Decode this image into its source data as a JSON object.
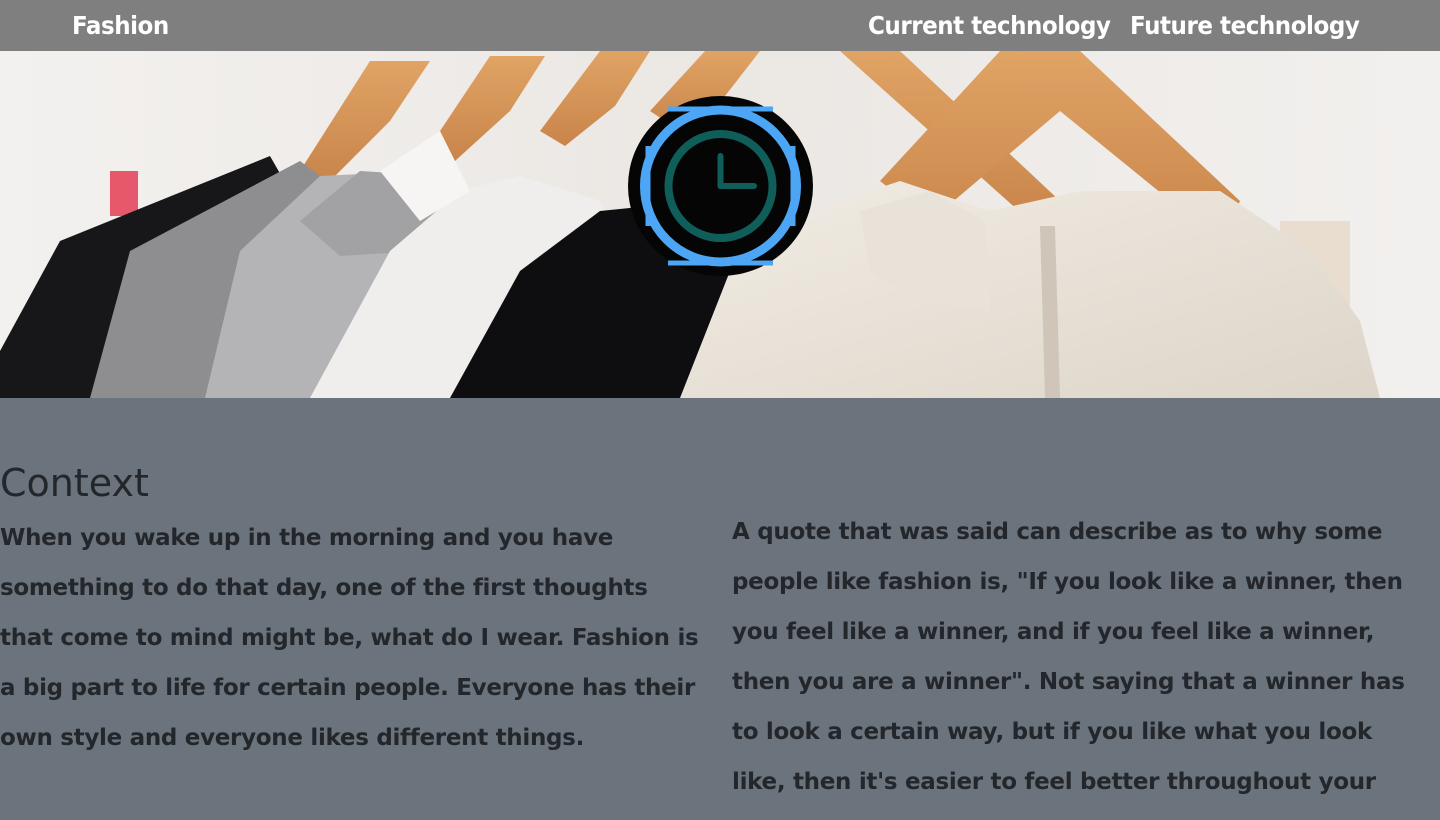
{
  "nav": {
    "brand": "Fashion",
    "links": [
      {
        "label": "Current technology"
      },
      {
        "label": "Future technology"
      }
    ]
  },
  "hero": {
    "image_icon": "clothes-on-hangers-photo",
    "badge_icon": "clock-icon"
  },
  "context": {
    "title": "Context",
    "left_paragraph": "When you wake up in the morning and you have something to do that day, one of the first thoughts that come to mind might be, what do I wear. Fashion is a big part to life for certain people. Everyone has their own style and everyone likes different things.",
    "right_paragraph": "A quote that was said can describe as to why some people like fashion is, \"If you look like a winner, then you feel like a winner, and if you feel like a winner, then you are a winner\". Not saying that a winner has to look a certain way, but if you like what you look like, then it's easier to feel better throughout your day."
  },
  "colors": {
    "navbar": "#7f7f7f",
    "page_background": "#6b747d",
    "text": "#23272b",
    "badge_ring": "#4da6f5",
    "badge_clock": "#0f5e5a"
  }
}
